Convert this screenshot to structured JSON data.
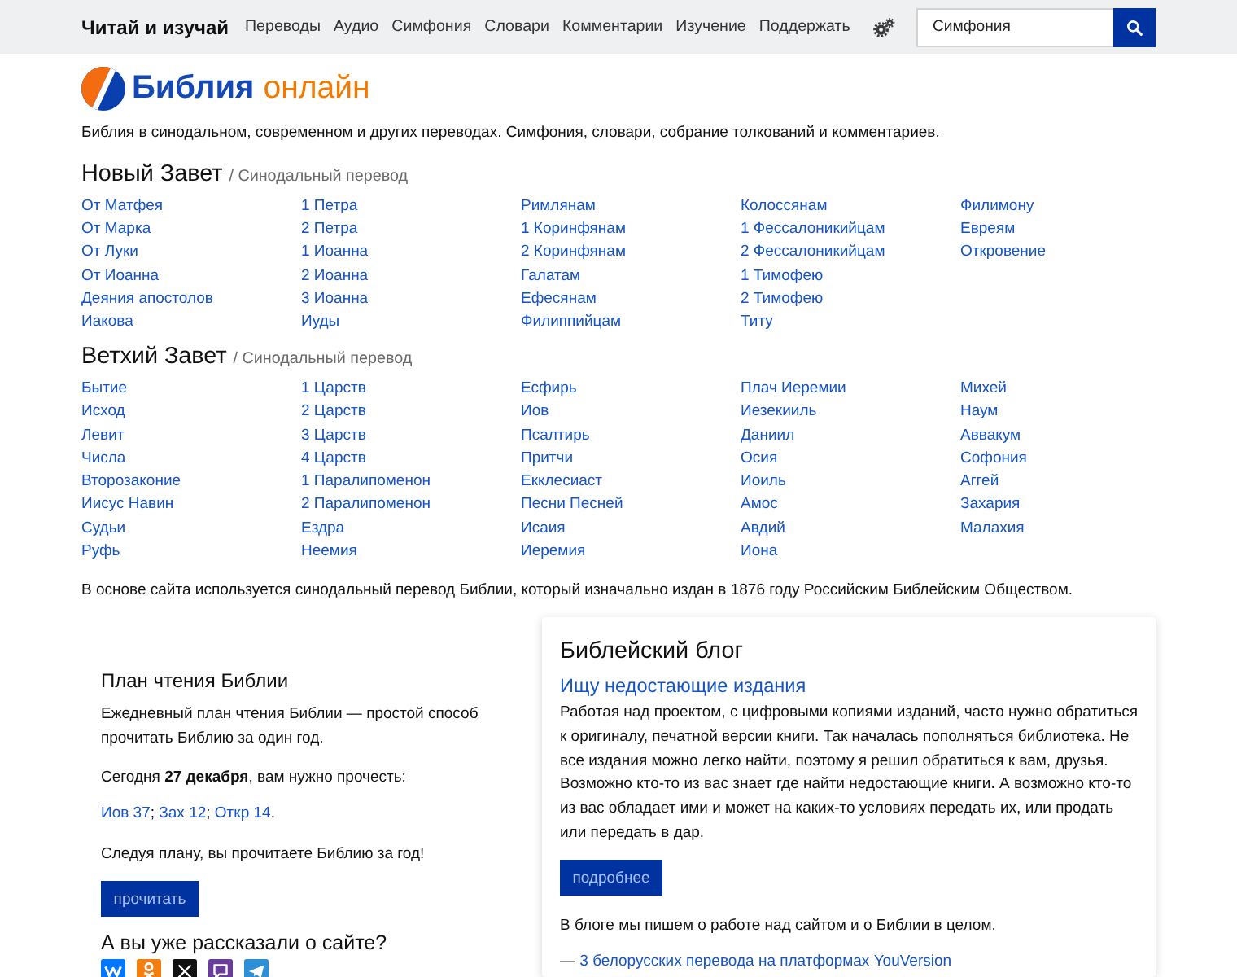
{
  "navbar": {
    "brand": "Читай и изучай",
    "links": [
      "Переводы",
      "Аудио",
      "Симфония",
      "Словари",
      "Комментарии",
      "Изучение",
      "Поддержать"
    ],
    "search": {
      "value": "Симфония"
    }
  },
  "logo": {
    "name": "Библия",
    "suffix": "онлайн"
  },
  "tagline": "Библия в синодальном, современном и других переводах. Симфония, словари, собрание толкований и комментариев.",
  "testaments": [
    {
      "title": "Новый Завет",
      "subtitle": "/ Синодальный перевод",
      "columns": [
        {
          "books": [
            "От Матфея",
            "От Марка",
            "От Луки",
            "От Иоанна",
            "Деяния апостолов",
            "Иакова"
          ]
        },
        {
          "books": [
            "1 Петра",
            "2 Петра",
            "1 Иоанна",
            "2 Иоанна",
            "3 Иоанна",
            "Иуды"
          ]
        },
        {
          "books": [
            "Римлянам",
            "1 Коринфянам",
            "2 Коринфянам",
            "Галатам",
            "Ефесянам",
            "Филиппийцам"
          ]
        },
        {
          "books": [
            "Колоссянам",
            "1 Фессалоникийцам",
            "2 Фессалоникийцам",
            "1 Тимофею",
            "2 Тимофею",
            "Титу"
          ]
        },
        {
          "books": [
            "Филимону",
            "Евреям",
            "Откровение"
          ]
        }
      ]
    },
    {
      "title": "Ветхий Завет",
      "subtitle": "/ Синодальный перевод",
      "columns": [
        {
          "books": [
            "Бытие",
            "Исход",
            "Левит",
            "Числа",
            "Второзаконие",
            "Иисус Навин",
            "Судьи",
            "Руфь"
          ]
        },
        {
          "books": [
            "1 Царств",
            "2 Царств",
            "3 Царств",
            "4 Царств",
            "1 Паралипоменон",
            "2 Паралипоменон",
            "Ездра",
            "Неемия"
          ]
        },
        {
          "books": [
            "Есфирь",
            "Иов",
            "Псалтирь",
            "Притчи",
            "Екклесиаст",
            "Песни Песней",
            "Исаия",
            "Иеремия"
          ]
        },
        {
          "books": [
            "Плач Иеремии",
            "Иезекииль",
            "Даниил",
            "Осия",
            "Иоиль",
            "Амос",
            "Авдий",
            "Иона"
          ]
        },
        {
          "books": [
            "Михей",
            "Наум",
            "Аввакум",
            "Софония",
            "Аггей",
            "Захария",
            "Малахия"
          ]
        }
      ]
    }
  ],
  "note": "В основе сайта используется синодальный перевод Библии, который изначально издан в 1876 году Российским Библейским Обществом.",
  "reading_plan": {
    "title": "План чтения Библии",
    "intro": "Ежедневный план чтения Библии — простой способ прочитать Библию за один год.",
    "today": "Сегодня **27 декабря**, вам нужно прочесть:",
    "readings": [
      {
        "label": "Иов 37",
        "after": ";"
      },
      {
        "label": "Зах 12",
        "after": ";"
      },
      {
        "label": "Откр 14",
        "after": "."
      }
    ],
    "closing": "Следуя плану, вы прочитаете Библию за год!",
    "button": "прочитать"
  },
  "share": {
    "title": "А вы уже рассказали о сайте?",
    "networks": [
      {
        "kind": "vk"
      },
      {
        "kind": "ok"
      },
      {
        "kind": "x"
      },
      {
        "kind": "viber"
      },
      {
        "kind": "telegram"
      }
    ]
  },
  "blog": {
    "title": "Библейский блог",
    "post_title": "Ищу недостающие издания",
    "post_text": "Работая над проектом, с цифровыми копиями изданий, часто нужно обратиться к оригиналу, печатной версии книги. Так началась пополняться библиотека. Не все издания можно легко найти, поэтому я решил обратиться к вам, друзья. Возможно кто-то из вас знает где найти недостающие книги. А возможно кто-то из вас обладает ими и может на каких-то условиях передать их, или продать или передать в дар.",
    "button": "подробнее",
    "about": "В блоге мы пишем о работе над сайтом и о Библии в целом.",
    "recent": [
      {
        "prefix": "—",
        "title": "3 белорусских перевода на платформах YouVersion"
      }
    ]
  }
}
